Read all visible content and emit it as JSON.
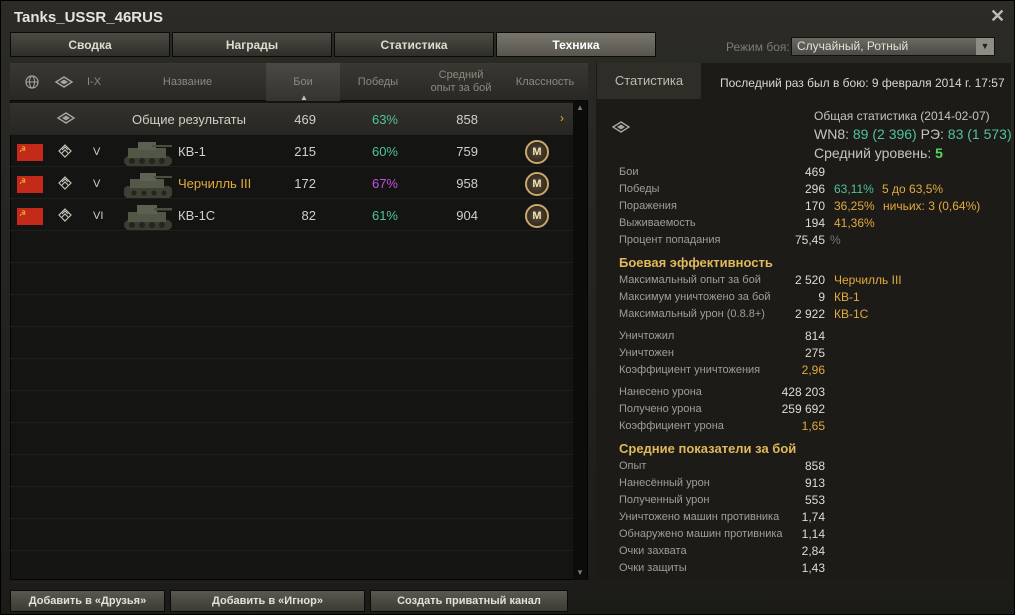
{
  "window": {
    "title": "Tanks_USSR_46RUS"
  },
  "tabs": [
    {
      "label": "Сводка"
    },
    {
      "label": "Награды"
    },
    {
      "label": "Статистика"
    },
    {
      "label": "Техника"
    }
  ],
  "mode": {
    "label": "Режим боя:",
    "value": "Случайный, Ротный"
  },
  "table": {
    "headers": {
      "tier": "I-X",
      "name": "Название",
      "battles": "Бои",
      "wins": "Победы",
      "avg_xp_1": "Средний",
      "avg_xp_2": "опыт за бой",
      "mastery": "Классность"
    },
    "total": {
      "name": "Общие результаты",
      "battles": "469",
      "wins": "63%",
      "avg_xp": "858"
    },
    "rows": [
      {
        "tier": "V",
        "name": "КВ-1",
        "battles": "215",
        "wins": "60%",
        "avg_xp": "759",
        "mastery": "M",
        "wins_color": "#4fc39a",
        "name_color": "#d2cfc5"
      },
      {
        "tier": "V",
        "name": "Черчилль III",
        "battles": "172",
        "wins": "67%",
        "avg_xp": "958",
        "mastery": "M",
        "wins_color": "#c44fe0",
        "name_color": "#e3aa3c"
      },
      {
        "tier": "VI",
        "name": "КВ-1С",
        "battles": "82",
        "wins": "61%",
        "avg_xp": "904",
        "mastery": "M",
        "wins_color": "#4fc39a",
        "name_color": "#d2cfc5"
      }
    ]
  },
  "stats": {
    "tab_label": "Статистика",
    "last_battle": "Последний раз был в бою: 9 февраля 2014 г. 17:57",
    "overall_title": "Общая статистика (2014-02-07)",
    "wn8_label": "WN8:",
    "wn8_value": "89",
    "wn8_extra": "(2 396)",
    "re_label": "РЭ:",
    "re_value": "83",
    "re_extra": "(1 573)",
    "avg_level_label": "Средний уровень:",
    "avg_level_value": "5",
    "general": [
      {
        "label": "Бои",
        "value": "469"
      },
      {
        "label": "Победы",
        "value": "296",
        "extra1": "63,11%",
        "extra2": "5 до 63,5%"
      },
      {
        "label": "Поражения",
        "value": "170",
        "extra1": "36,25%",
        "extra2": "ничьих: 3 (0,64%)"
      },
      {
        "label": "Выживаемость",
        "value": "194",
        "extra1": "41,36%"
      },
      {
        "label": "Процент попадания",
        "value": "75,45",
        "extra1": "%"
      }
    ],
    "combat_title": "Боевая эффективность",
    "combat": [
      {
        "label": "Максимальный опыт за бой",
        "value": "2 520",
        "extra1": "Черчилль III"
      },
      {
        "label": "Максимум уничтожено за бой",
        "value": "9",
        "extra1": "КВ-1"
      },
      {
        "label": "Максимальный урон (0.8.8+)",
        "value": "2 922",
        "extra1": "КВ-1С"
      },
      {
        "label": "Уничтожил",
        "value": "814"
      },
      {
        "label": "Уничтожен",
        "value": "275"
      },
      {
        "label": "Коэффициент уничтожения",
        "value": "2,96"
      },
      {
        "label": "Нанесено урона",
        "value": "428 203"
      },
      {
        "label": "Получено урона",
        "value": "259 692"
      },
      {
        "label": "Коэффициент урона",
        "value": "1,65"
      }
    ],
    "avg_title": "Средние показатели за бой",
    "avg": [
      {
        "label": "Опыт",
        "value": "858"
      },
      {
        "label": "Нанесённый урон",
        "value": "913"
      },
      {
        "label": "Полученный урон",
        "value": "553"
      },
      {
        "label": "Уничтожено машин противника",
        "value": "1,74"
      },
      {
        "label": "Обнаружено машин противника",
        "value": "1,14"
      },
      {
        "label": "Очки захвата",
        "value": "2,84"
      },
      {
        "label": "Очки защиты",
        "value": "1,43"
      }
    ]
  },
  "buttons": {
    "add_friend": "Добавить в «Друзья»",
    "add_ignore": "Добавить в «Игнор»",
    "private_channel": "Создать приватный канал"
  },
  "colors": {
    "accent": "#e1b95a",
    "green": "#4fc39a",
    "orange": "#e3aa3c",
    "purple": "#c44fe0"
  },
  "icons": [
    "close-icon",
    "globe-icon",
    "tank-type-icon",
    "soviet-flag-icon",
    "mastery-badge-icon",
    "chevron-right-icon"
  ]
}
